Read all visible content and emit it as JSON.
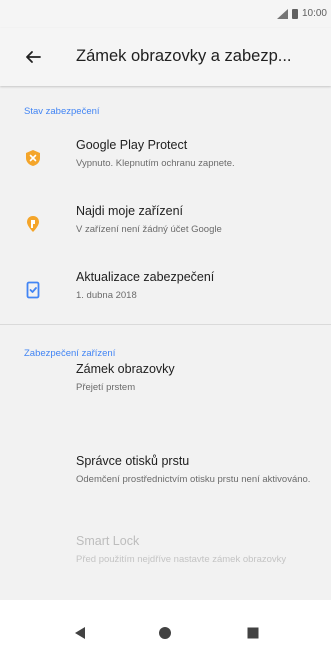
{
  "status_bar": {
    "time": "10:00",
    "icons": [
      "signal-icon",
      "battery-icon"
    ]
  },
  "app_bar": {
    "back_icon": "arrow-left-icon",
    "title": "Zámek obrazovky a zabezp..."
  },
  "sections": [
    {
      "header": "Stav zabezpečení",
      "items": [
        {
          "icon": "shield-icon",
          "icon_color": "#f4a52a",
          "title": "Google Play Protect",
          "subtitle": "Vypnuto. Klepnutím ochranu zapnete."
        },
        {
          "icon": "location-pin-icon",
          "icon_color": "#f4a52a",
          "title": "Najdi moje zařízení",
          "subtitle": "V zařízení není žádný účet Google"
        },
        {
          "icon": "security-update-icon",
          "icon_color": "#4285f4",
          "title": "Aktualizace zabezpečení",
          "subtitle": "1. dubna 2018"
        }
      ]
    },
    {
      "header": "Zabezpečení zařízení",
      "items": [
        {
          "title": "Zámek obrazovky",
          "subtitle": "Přejetí prstem",
          "enabled": true
        },
        {
          "title": "Správce otisků prstu",
          "subtitle": "Odemčení prostřednictvím otisku prstu není aktivováno.",
          "enabled": true
        },
        {
          "title": "Smart Lock",
          "subtitle": "Před použitím nejdříve nastavte zámek obrazovky",
          "enabled": false
        }
      ]
    }
  ],
  "nav_bar": {
    "buttons": [
      "back-triangle-icon",
      "home-circle-icon",
      "recents-square-icon"
    ]
  },
  "colors": {
    "accent": "#4285f4",
    "warning": "#f4a52a",
    "background": "#f2f2f2"
  }
}
